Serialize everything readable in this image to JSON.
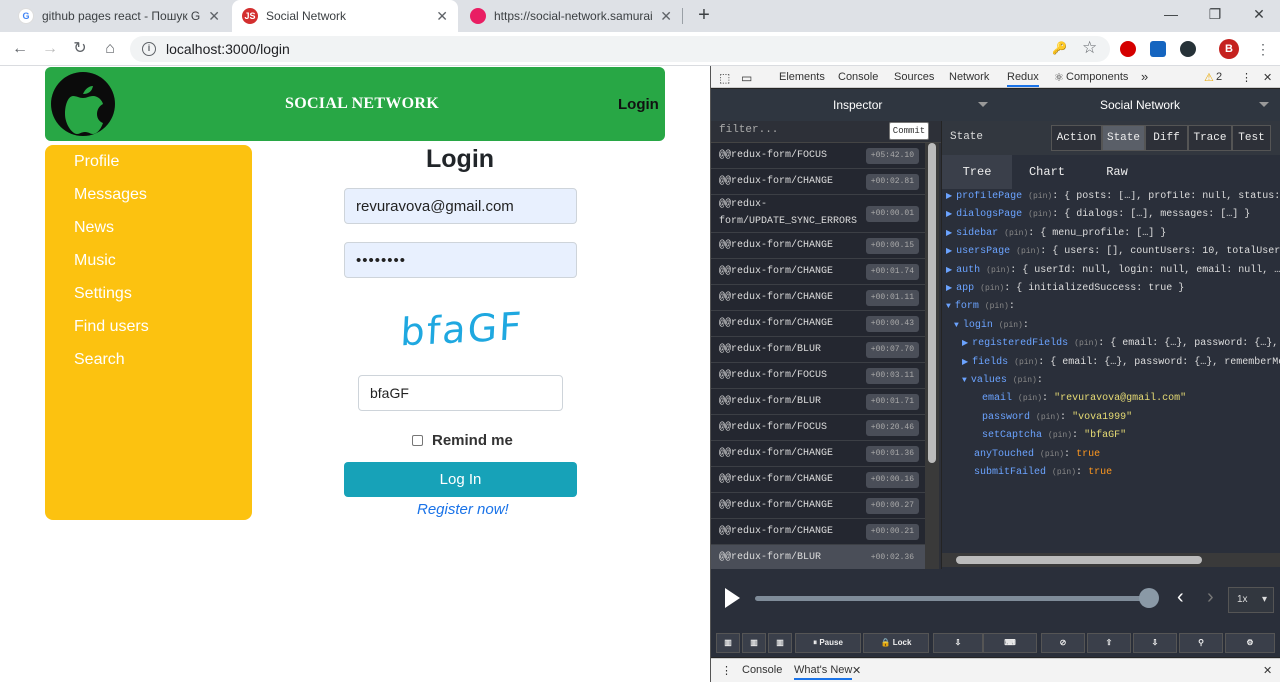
{
  "browser": {
    "tabs": [
      {
        "title": "github pages react - Пошук Goo",
        "active": false
      },
      {
        "title": "Social Network",
        "active": true
      },
      {
        "title": "https://social-network.samuraijs.c",
        "active": false
      }
    ],
    "url": "localhost:3000/login",
    "avatar_letter": "B",
    "icons": {
      "back": "←",
      "forward": "→",
      "reload": "↻",
      "home": "⌂",
      "close": "✕",
      "new_tab": "+",
      "minimize": "—",
      "maximize": "❐",
      "key": "🔑",
      "star": "☆",
      "info": "i",
      "js_favicon": "JS"
    }
  },
  "app": {
    "site_title": "SOCIAL NETWORK",
    "header_login": "Login",
    "nav": [
      "Profile",
      "Messages",
      "News",
      "Music",
      "Settings",
      "Find users",
      "Search"
    ],
    "login_title": "Login",
    "email_value": "revuravova@gmail.com",
    "password_value": "••••••••",
    "captcha_text": "bfaGF",
    "captcha_input_value": "bfaGF",
    "remember_label": "Remind me",
    "login_button": "Log In",
    "register_link": "Register now!"
  },
  "devtools": {
    "tabs": [
      "Elements",
      "Console",
      "Sources",
      "Network",
      "Redux",
      "Components"
    ],
    "selected_tab": "Redux",
    "more_tabs": "»",
    "warnings": "2",
    "warning_icon": "⚠",
    "menu_icon": "⋮",
    "close_icon": "✕",
    "components_icon": "⚛",
    "redux": {
      "monitor": "Inspector",
      "instance": "Social Network",
      "filter_placeholder": "filter...",
      "commit_label": "Commit",
      "actions": [
        {
          "type": "@@redux-form/FOCUS",
          "time": "+05:42.10"
        },
        {
          "type": "@@redux-form/CHANGE",
          "time": "+00:02.81"
        },
        {
          "type": "@@redux-form/UPDATE_SYNC_ERRORS",
          "line1": "@@redux-",
          "line2": "form/UPDATE_SYNC_ERRORS",
          "time": "+00:00.01"
        },
        {
          "type": "@@redux-form/CHANGE",
          "time": "+00:00.15"
        },
        {
          "type": "@@redux-form/CHANGE",
          "time": "+00:01.74"
        },
        {
          "type": "@@redux-form/CHANGE",
          "time": "+00:01.11"
        },
        {
          "type": "@@redux-form/CHANGE",
          "time": "+00:00.43"
        },
        {
          "type": "@@redux-form/BLUR",
          "time": "+00:07.70"
        },
        {
          "type": "@@redux-form/FOCUS",
          "time": "+00:03.11"
        },
        {
          "type": "@@redux-form/BLUR",
          "time": "+00:01.71"
        },
        {
          "type": "@@redux-form/FOCUS",
          "time": "+00:20.46"
        },
        {
          "type": "@@redux-form/CHANGE",
          "time": "+00:01.36"
        },
        {
          "type": "@@redux-form/CHANGE",
          "time": "+00:00.16"
        },
        {
          "type": "@@redux-form/CHANGE",
          "time": "+00:00.27"
        },
        {
          "type": "@@redux-form/CHANGE",
          "time": "+00:00.21"
        },
        {
          "type": "@@redux-form/BLUR",
          "time": "+00:02.36"
        }
      ],
      "state_label": "State",
      "modes": [
        "Action",
        "State",
        "Diff",
        "Trace",
        "Test"
      ],
      "selected_mode": "State",
      "views": [
        "Tree",
        "Chart",
        "Raw"
      ],
      "selected_view": "Tree",
      "pin": "(pin)",
      "tree": [
        {
          "key": "profilePage",
          "value": "{ posts: […], profile: null, status: \"\", …",
          "arrow": "▶"
        },
        {
          "key": "dialogsPage",
          "value": "{ dialogs: […], messages: […] }",
          "arrow": "▶"
        },
        {
          "key": "sidebar",
          "value": "{ menu_profile: […] }",
          "arrow": "▶"
        },
        {
          "key": "usersPage",
          "value": "{ users: [], countUsers: 10, totalUsers: 0, …",
          "arrow": "▶"
        },
        {
          "key": "auth",
          "value": "{ userId: null, login: null, email: null, … }",
          "arrow": "▶"
        },
        {
          "key": "app",
          "value": "{ initializedSuccess: true }",
          "arrow": "▶"
        },
        {
          "key": "form",
          "value": "",
          "arrow": "▼"
        },
        {
          "key": "login",
          "value": "",
          "arrow": "▼"
        },
        {
          "key": "registeredFields",
          "value": "{ email: {…}, password: {…}, remem…",
          "arrow": "▶"
        },
        {
          "key": "fields",
          "value": "{ email: {…}, password: {…}, rememberMe: {…",
          "arrow": "▶"
        },
        {
          "key": "values",
          "value": "",
          "arrow": "▼"
        },
        {
          "key": "email",
          "value": "\"revuravova@gmail.com\"",
          "arrow": "",
          "kind": "string"
        },
        {
          "key": "password",
          "value": "\"vova1999\"",
          "arrow": "",
          "kind": "string"
        },
        {
          "key": "setCaptcha",
          "value": "\"bfaGF\"",
          "arrow": "",
          "kind": "string"
        },
        {
          "key": "anyTouched",
          "value": "true",
          "arrow": "",
          "kind": "bool"
        },
        {
          "key": "submitFailed",
          "value": "true",
          "arrow": "",
          "kind": "bool"
        }
      ],
      "speed": "1x",
      "speed_caret": "▾",
      "prev_icon": "‹",
      "next_icon": "›",
      "bottom_buttons": [
        "▥",
        "▥",
        "▥",
        "Pause",
        "Lock",
        "",
        "",
        "",
        "",
        "",
        "",
        ""
      ],
      "bottom_icons": {
        "pause": "⏸",
        "lock": "🔒",
        "pin": "⇩",
        "keyboard": "⌨",
        "no": "⊘",
        "up": "⇧",
        "down": "⇩",
        "broadcast": "⚲",
        "gear": "⚙"
      }
    },
    "drawer_tabs": [
      "Console",
      "What's New"
    ],
    "drawer_menu": "⋮"
  }
}
